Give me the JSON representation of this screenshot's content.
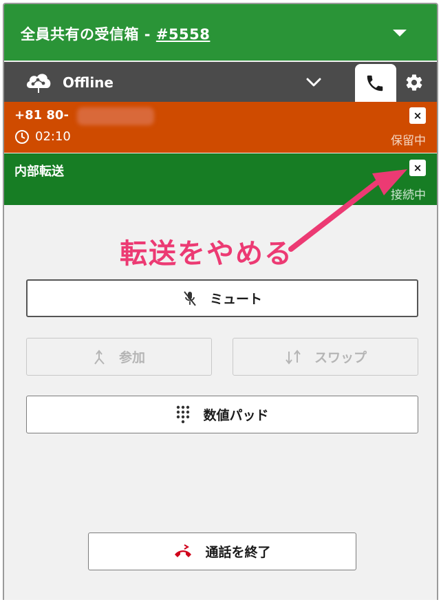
{
  "header": {
    "title_prefix": "全員共有の受信箱 - ",
    "queue_number": "#5558"
  },
  "status": {
    "label": "Offline"
  },
  "call": {
    "number_prefix": "+81 80-",
    "timer": "02:10",
    "state": "保留中",
    "close_label": "×"
  },
  "transfer": {
    "label": "内部転送",
    "state": "接続中",
    "close_label": "×"
  },
  "annotation": {
    "text": "転送をやめる",
    "color": "#ec3a73"
  },
  "buttons": {
    "mute": "ミュート",
    "join": "参加",
    "swap": "スワップ",
    "keypad": "数値パッド",
    "end_call": "通話を終了"
  },
  "colors": {
    "header": "#2a9437",
    "statusbar": "#4b4b4b",
    "call_row": "#cf4b00",
    "transfer_row": "#177d24",
    "end_call_icon": "#d0021b"
  },
  "icons": {
    "status": "cloud-network-icon",
    "dropdown": "chevron-down-icon",
    "phone_tab": "phone-icon",
    "settings": "gear-icon",
    "timer": "clock-icon",
    "mute": "mic-off-icon",
    "join": "merge-arrow-icon",
    "swap": "swap-arrows-icon",
    "keypad": "dialpad-icon",
    "end_call": "hangup-icon"
  }
}
